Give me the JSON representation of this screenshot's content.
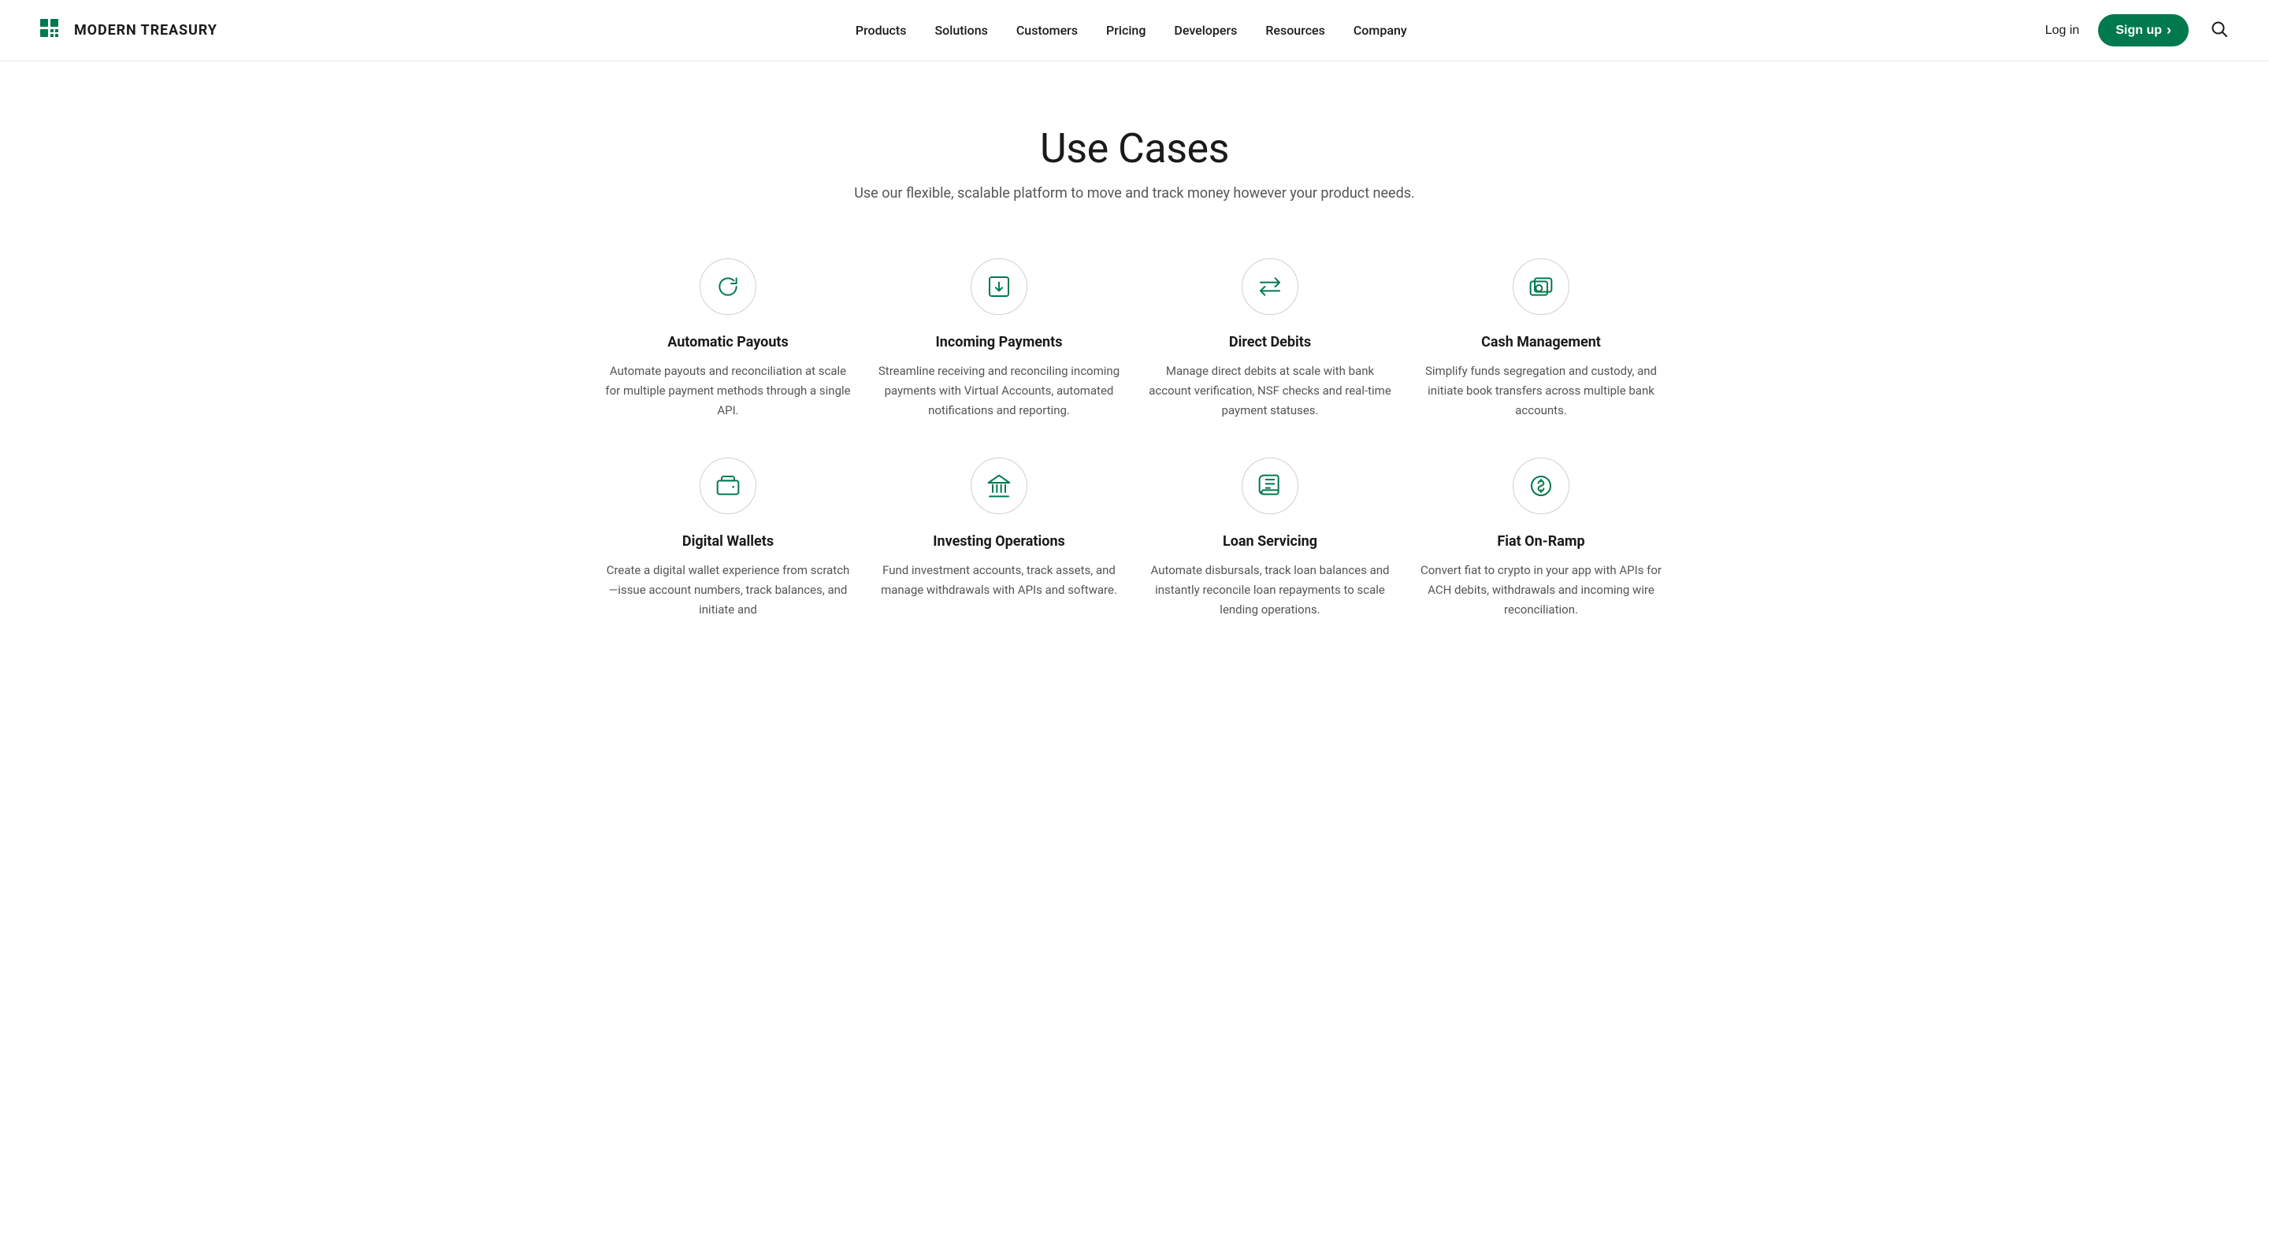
{
  "header": {
    "logo_text": "MODERN TREASURY",
    "nav_items": [
      {
        "label": "Products",
        "href": "#"
      },
      {
        "label": "Solutions",
        "href": "#"
      },
      {
        "label": "Customers",
        "href": "#"
      },
      {
        "label": "Pricing",
        "href": "#"
      },
      {
        "label": "Developers",
        "href": "#"
      },
      {
        "label": "Resources",
        "href": "#"
      },
      {
        "label": "Company",
        "href": "#"
      }
    ],
    "log_in_label": "Log in",
    "sign_up_label": "Sign up",
    "sign_up_arrow": "›"
  },
  "main": {
    "title": "Use Cases",
    "subtitle": "Use our flexible, scalable platform to move and track money however your product needs.",
    "cards": [
      {
        "id": "automatic-payouts",
        "title": "Automatic Payouts",
        "description": "Automate payouts and reconciliation at scale for multiple payment methods through a single API.",
        "icon": "refresh"
      },
      {
        "id": "incoming-payments",
        "title": "Incoming Payments",
        "description": "Streamline receiving and reconciling incoming payments with Virtual Accounts, automated notifications and reporting.",
        "icon": "download-box"
      },
      {
        "id": "direct-debits",
        "title": "Direct Debits",
        "description": "Manage direct debits at scale with bank account verification, NSF checks and real-time payment statuses.",
        "icon": "transfer"
      },
      {
        "id": "cash-management",
        "title": "Cash Management",
        "description": "Simplify funds segregation and custody, and initiate book transfers across multiple bank accounts.",
        "icon": "camera-stack"
      },
      {
        "id": "digital-wallets",
        "title": "Digital Wallets",
        "description": "Create a digital wallet experience from scratch—issue account numbers, track balances, and initiate and",
        "icon": "wallet"
      },
      {
        "id": "investing-operations",
        "title": "Investing Operations",
        "description": "Fund investment accounts, track assets, and manage withdrawals with APIs and software.",
        "icon": "bank"
      },
      {
        "id": "loan-servicing",
        "title": "Loan Servicing",
        "description": "Automate disbursals, track loan balances and instantly reconcile loan repayments to scale lending operations.",
        "icon": "book"
      },
      {
        "id": "fiat-on-ramp",
        "title": "Fiat On-Ramp",
        "description": "Convert fiat to crypto in your app with APIs for ACH debits, withdrawals and incoming wire reconciliation.",
        "icon": "dollar-circle"
      }
    ]
  }
}
